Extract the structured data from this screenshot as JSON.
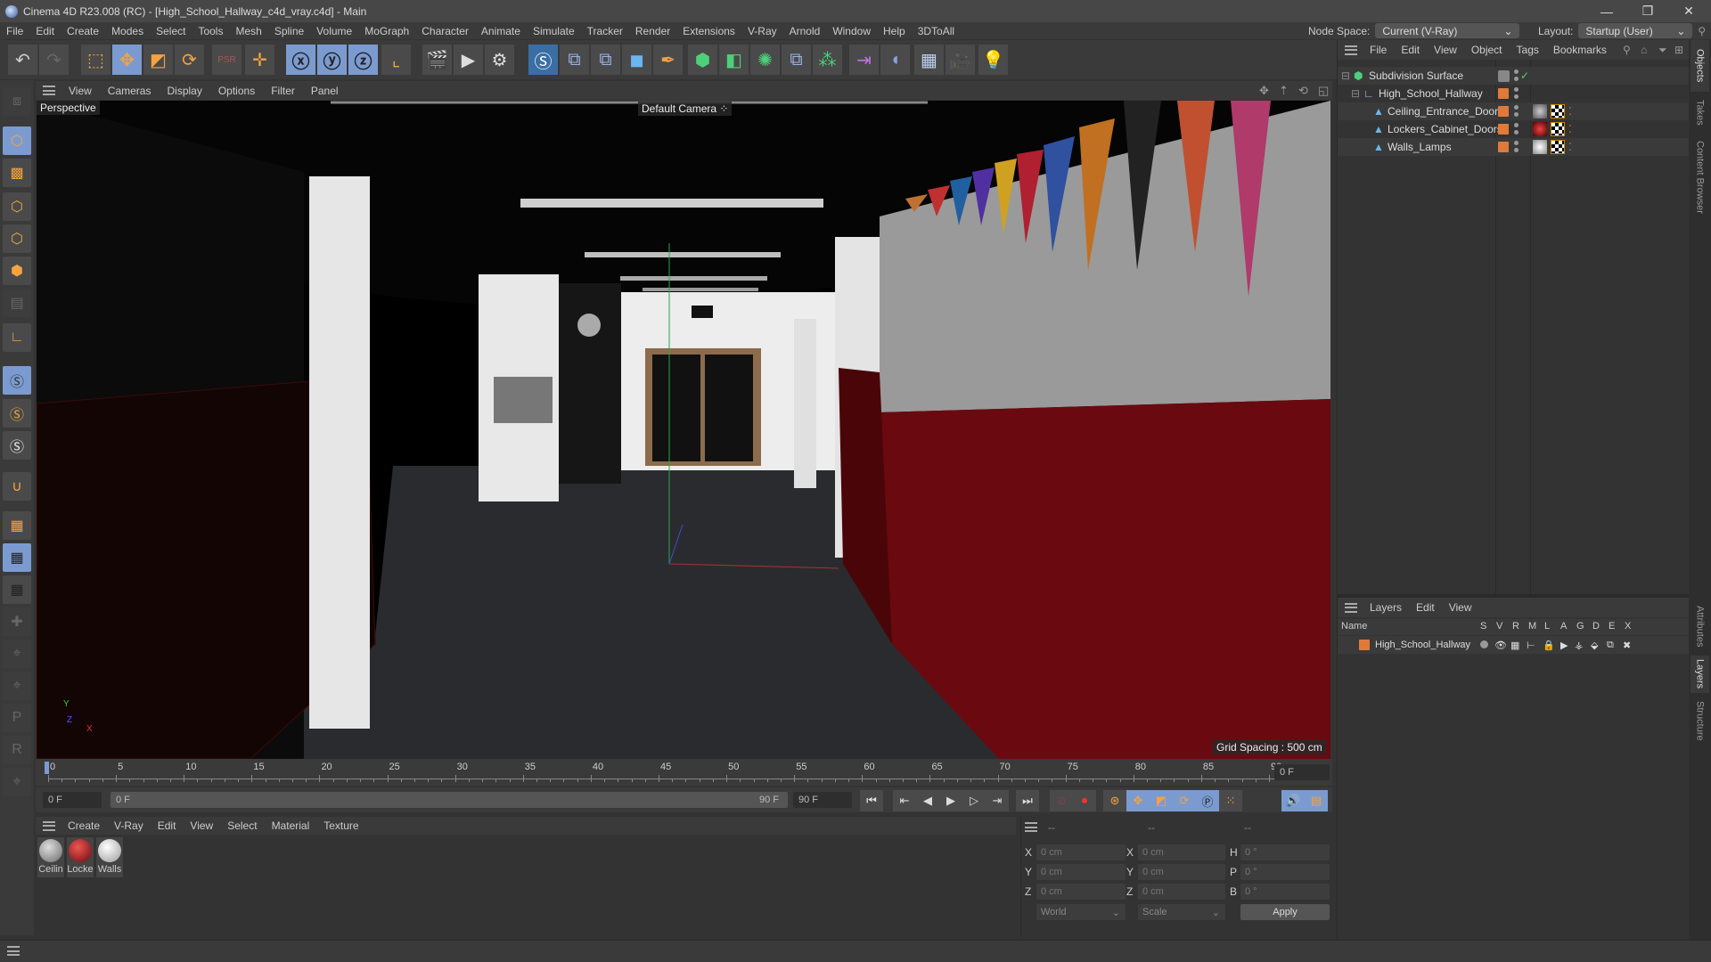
{
  "window": {
    "title": "Cinema 4D R23.008 (RC) - [High_School_Hallway_c4d_vray.c4d] - Main",
    "controls": {
      "minimize": "—",
      "restore": "❐",
      "close": "✕"
    }
  },
  "menubar": {
    "items": [
      "File",
      "Edit",
      "Create",
      "Modes",
      "Select",
      "Tools",
      "Mesh",
      "Spline",
      "Volume",
      "MoGraph",
      "Character",
      "Animate",
      "Simulate",
      "Tracker",
      "Render",
      "Extensions",
      "V-Ray",
      "Arnold",
      "Window",
      "Help",
      "3DToAll"
    ],
    "node_space_label": "Node Space:",
    "node_space_value": "Current (V-Ray)",
    "layout_label": "Layout:",
    "layout_value": "Startup (User)"
  },
  "toolbar": {
    "icons": [
      "undo-icon",
      "redo-icon",
      "live-selection-icon",
      "move-icon",
      "scale-icon",
      "rotate-icon",
      "psr-icon",
      "world-move-icon",
      "x-axis-icon",
      "y-axis-icon",
      "z-axis-icon",
      "coordinate-system-icon",
      "render-view-icon",
      "render-picture-viewer-icon",
      "render-settings-icon",
      "vray-icon",
      "python-icon-1",
      "python-icon-2",
      "cube-icon",
      "pen-icon",
      "subdivision-icon",
      "extrude-icon",
      "cloner-icon",
      "python-icon-3",
      "mograph-icon",
      "symmetry-icon",
      "deformer-icon",
      "floor-icon",
      "camera-icon",
      "light-icon"
    ]
  },
  "left_tools": {
    "icons": [
      "make-editable-icon",
      "model-mode-icon",
      "texture-mode-icon",
      "point-mode-icon",
      "edge-mode-icon",
      "polygon-mode-icon",
      "uv-mode-icon",
      "axis-mode-icon",
      "snap-icon",
      "snap-settings-icon",
      "snap-workplane-icon",
      "magnet-icon",
      "workplane-icon",
      "lock-workplane-icon",
      "workplane-rotate-icon",
      "pin-add-icon",
      "pin-target-icon",
      "pin-sphere-icon",
      "pin-p-icon",
      "pin-r-icon",
      "pin-cube-icon"
    ]
  },
  "viewport": {
    "menu": [
      "View",
      "Cameras",
      "Display",
      "Options",
      "Filter",
      "Panel"
    ],
    "view_name": "Perspective",
    "camera": "Default Camera",
    "grid_spacing": "Grid Spacing : 500 cm",
    "nav_icons": [
      "move-view-icon",
      "zoom-view-icon",
      "rotate-view-icon",
      "maximize-view-icon"
    ],
    "axis_labels": {
      "y": "Y",
      "z": "Z",
      "x": "X"
    }
  },
  "timeline": {
    "ticks": [
      "0",
      "5",
      "10",
      "15",
      "20",
      "25",
      "30",
      "35",
      "40",
      "45",
      "50",
      "55",
      "60",
      "65",
      "70",
      "75",
      "80",
      "85",
      "90"
    ],
    "current_frame_right": "0 F",
    "start_frame": "0 F",
    "range_start": "0 F",
    "range_end": "90 F",
    "end_frame": "90 F"
  },
  "transport": {
    "buttons": [
      "go-to-start-icon",
      "prev-key-icon",
      "prev-frame-icon",
      "play-icon",
      "next-frame-icon",
      "next-key-icon",
      "go-to-end-icon",
      "record-off-icon",
      "record-icon",
      "keyframe-icon",
      "key-move-icon",
      "key-scale-icon",
      "key-rotate-icon",
      "key-param-icon",
      "key-pla-icon",
      "sound-icon",
      "timeline-icon"
    ]
  },
  "materials": {
    "menu": [
      "Create",
      "V-Ray",
      "Edit",
      "View",
      "Select",
      "Material",
      "Texture"
    ],
    "items": [
      {
        "label": "Ceilin",
        "color": "#8a8a8a"
      },
      {
        "label": "Locke",
        "color": "#8a1a1a"
      },
      {
        "label": "Walls",
        "color": "#cfcfcf"
      }
    ]
  },
  "coordinates": {
    "headers": [
      "--",
      "--",
      "--"
    ],
    "rows": [
      {
        "l1": "X",
        "v1": "0 cm",
        "l2": "X",
        "v2": "0 cm",
        "l3": "H",
        "v3": "0 °"
      },
      {
        "l1": "Y",
        "v1": "0 cm",
        "l2": "Y",
        "v2": "0 cm",
        "l3": "P",
        "v3": "0 °"
      },
      {
        "l1": "Z",
        "v1": "0 cm",
        "l2": "Z",
        "v2": "0 cm",
        "l3": "B",
        "v3": "0 °"
      }
    ],
    "mode": "World",
    "size_mode": "Scale",
    "apply": "Apply"
  },
  "objects": {
    "menu": [
      "File",
      "Edit",
      "View",
      "Object",
      "Tags",
      "Bookmarks"
    ],
    "items": [
      {
        "name": "Subdivision Surface",
        "level": 0
      },
      {
        "name": "High_School_Hallway",
        "level": 1
      },
      {
        "name": "Ceiling_Entrance_Doors",
        "level": 2
      },
      {
        "name": "Lockers_Cabinet_Doors",
        "level": 2
      },
      {
        "name": "Walls_Lamps",
        "level": 2
      }
    ]
  },
  "layers": {
    "menu": [
      "Layers",
      "Edit",
      "View"
    ],
    "columns": [
      "Name",
      "S",
      "V",
      "R",
      "M",
      "L",
      "A",
      "G",
      "D",
      "E",
      "X"
    ],
    "rows": [
      {
        "name": "High_School_Hallway",
        "color": "#e07a3a"
      }
    ]
  },
  "side_tabs": {
    "top": [
      "Objects",
      "Takes",
      "Content Browser"
    ],
    "bottom": [
      "Attributes",
      "Layers",
      "Structure"
    ]
  },
  "colors": {
    "accent": "#7b9bd0",
    "orange": "#f4a340",
    "layer": "#e07a3a"
  }
}
